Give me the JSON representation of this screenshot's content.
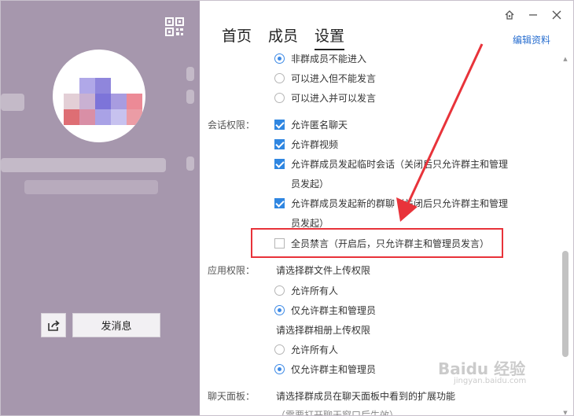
{
  "tabs": [
    {
      "label": "首页",
      "active": false
    },
    {
      "label": "成员",
      "active": false
    },
    {
      "label": "设置",
      "active": true
    }
  ],
  "header": {
    "edit_label": "编辑资料"
  },
  "left": {
    "send_message_label": "发消息"
  },
  "entry_options": [
    {
      "label": "非群成员不能进入",
      "selected": true
    },
    {
      "label": "可以进入但不能发言",
      "selected": false
    },
    {
      "label": "可以进入并可以发言",
      "selected": false
    }
  ],
  "chat_permissions": {
    "label": "会话权限：",
    "items": [
      {
        "label": "允许匿名聊天",
        "checked": true
      },
      {
        "label": "允许群视频",
        "checked": true
      },
      {
        "label": "允许群成员发起临时会话（关闭后只允许群主和管理",
        "label2": "员发起）",
        "checked": true
      },
      {
        "label": "允许群成员发起新的群聊（关闭后只允许群主和管理",
        "label2": "员发起）",
        "checked": true
      },
      {
        "label": "全员禁言（开启后，只允许群主和管理员发言）",
        "checked": false
      }
    ]
  },
  "app_permissions": {
    "label": "应用权限：",
    "file_prompt": "请选择群文件上传权限",
    "file_options": [
      {
        "label": "允许所有人",
        "selected": false
      },
      {
        "label": "仅允许群主和管理员",
        "selected": true
      }
    ],
    "album_prompt": "请选择群相册上传权限",
    "album_options": [
      {
        "label": "允许所有人",
        "selected": false
      },
      {
        "label": "仅允许群主和管理员",
        "selected": true
      }
    ]
  },
  "chat_panel": {
    "label": "聊天面板：",
    "prompt": "请选择群成员在聊天面板中看到的扩展功能",
    "note": "（需要打开聊天窗口后生效）"
  },
  "watermark": {
    "text": "Baidu 经验",
    "sub": "jingyan.baidu.com"
  },
  "colors": {
    "accent": "#2f86e1",
    "highlight": "#e8333a",
    "left_panel": "#a697ad"
  }
}
